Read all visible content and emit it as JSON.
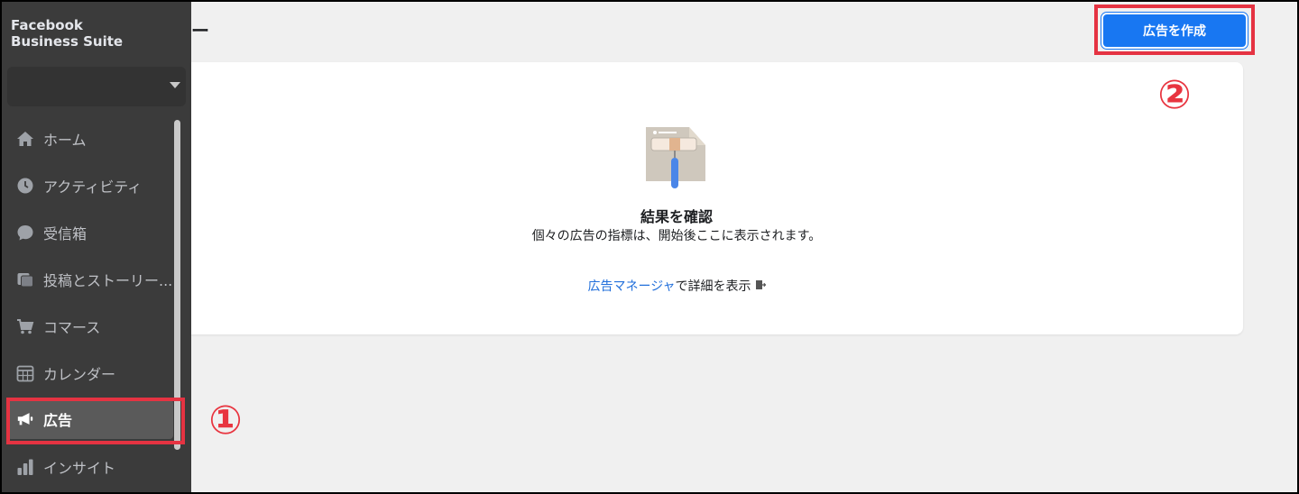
{
  "app": {
    "brand_line1": "Facebook",
    "brand_line2": "Business Suite"
  },
  "header": {
    "title_partial": "ー",
    "create_button": "広告を作成"
  },
  "sidebar": {
    "items": [
      {
        "label": "ホーム",
        "icon": "home-icon"
      },
      {
        "label": "アクティビティ",
        "icon": "activity-icon"
      },
      {
        "label": "受信箱",
        "icon": "inbox-icon"
      },
      {
        "label": "投稿とストーリー...",
        "icon": "posts-icon"
      },
      {
        "label": "コマース",
        "icon": "cart-icon"
      },
      {
        "label": "カレンダー",
        "icon": "calendar-icon"
      },
      {
        "label": "広告",
        "icon": "megaphone-icon",
        "active": true
      },
      {
        "label": "インサイト",
        "icon": "insights-icon"
      }
    ]
  },
  "main": {
    "empty_title": "結果を確認",
    "empty_desc": "個々の広告の指標は、開始後ここに表示されます。",
    "manager_link": "広告マネージャ",
    "manager_suffix": "で詳細を表示"
  },
  "annotations": {
    "marker_1": "①",
    "marker_2": "②",
    "highlight_color": "#e53342"
  },
  "colors": {
    "accent": "#1877f2",
    "sidebar_bg": "#3b3b3b",
    "link": "#216fdb"
  }
}
